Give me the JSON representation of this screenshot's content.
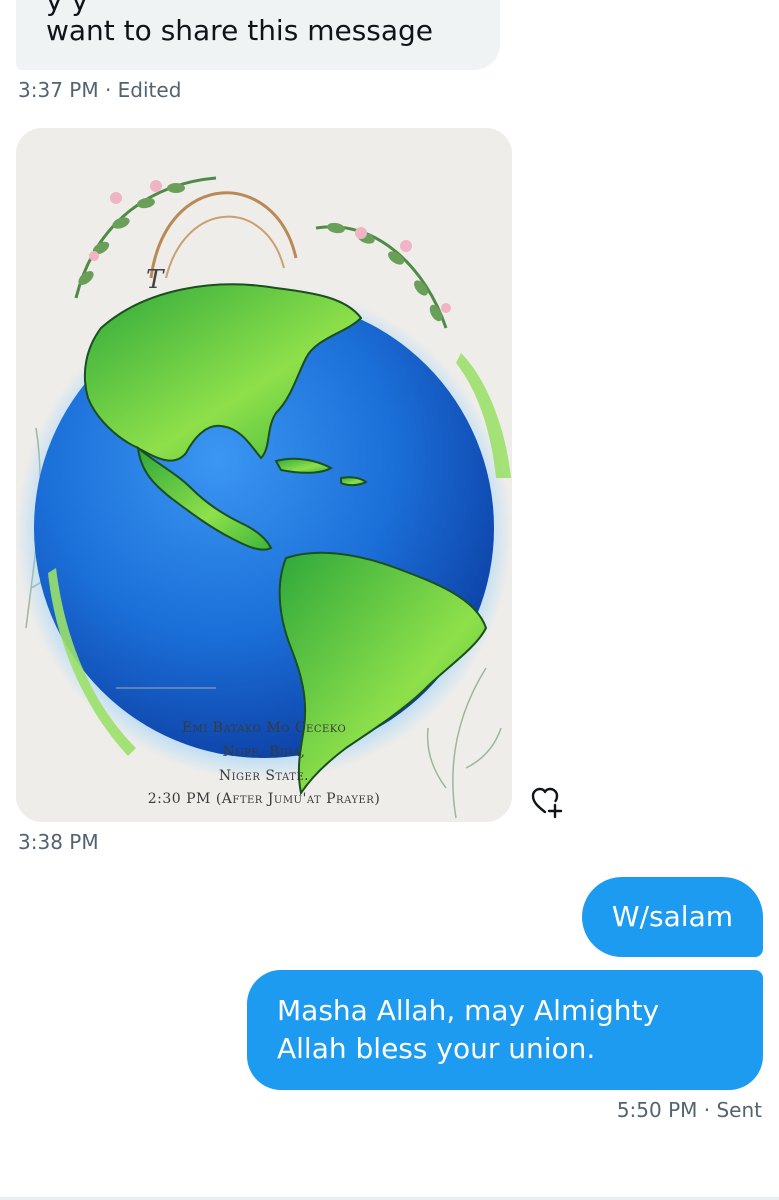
{
  "messages": {
    "received_text": {
      "prev_line_partial": "y                              y",
      "line": "want to share this message",
      "meta": "3:37 PM · Edited"
    },
    "received_image": {
      "invitation_lines": [
        "Emi Batako Mo      Ceceko",
        "Nupe, Bida,",
        "Niger State.",
        "2:30 PM (After Jumu'at Prayer)"
      ],
      "meta": "3:38 PM",
      "react_icon": "heart-plus-icon"
    },
    "sent": [
      {
        "text": "W/salam"
      },
      {
        "text": "Masha Allah, may Almighty Allah bless your union."
      }
    ],
    "sent_meta": "5:50 PM · Sent"
  },
  "colors": {
    "sent_bubble": "#1d9bf0",
    "received_bubble": "#eff3f4",
    "meta_text": "#536471",
    "ocean": "#1c6fd8",
    "land": "#7ed957"
  }
}
